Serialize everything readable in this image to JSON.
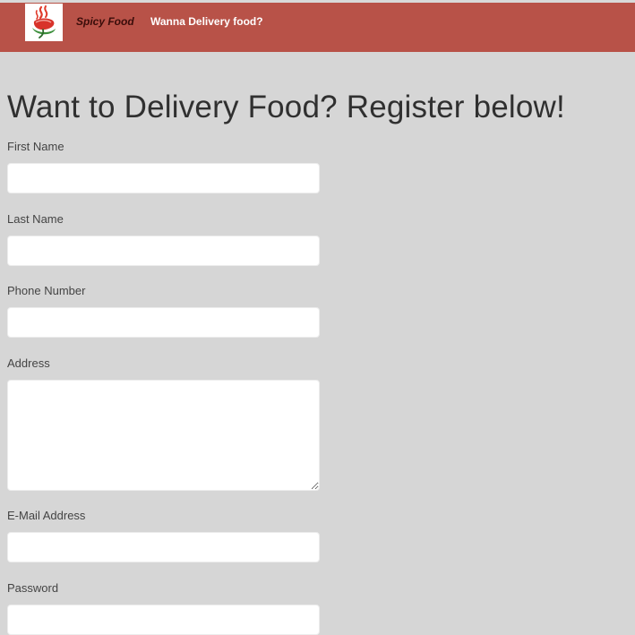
{
  "navbar": {
    "logo_icon": "chili-pepper-logo-icon",
    "brand": "Spicy Food",
    "link": "Wanna Delivery food?",
    "background_color": "#b85248"
  },
  "page": {
    "title": "Want to Delivery Food? Register below!",
    "background_color": "#d6d6d6"
  },
  "form": {
    "first_name_label": "First Name",
    "first_name_value": "",
    "last_name_label": "Last Name",
    "last_name_value": "",
    "phone_label": "Phone Number",
    "phone_value": "",
    "address_label": "Address",
    "address_value": "",
    "email_label": "E-Mail Address",
    "email_value": "",
    "password_label": "Password",
    "password_value": ""
  }
}
